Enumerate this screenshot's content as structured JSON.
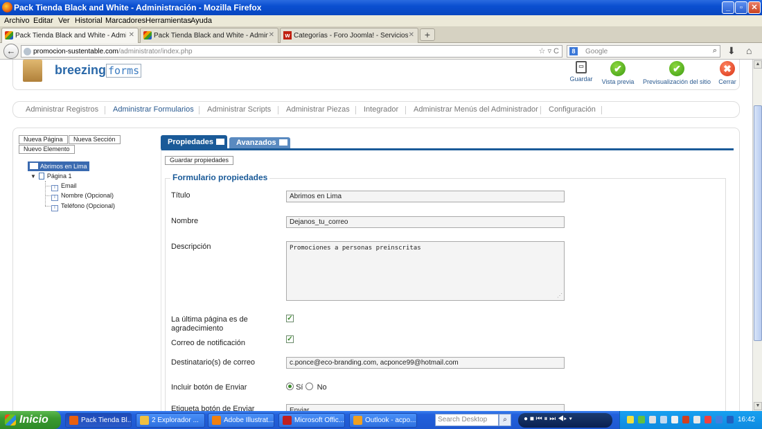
{
  "window": {
    "title": "Pack Tienda Black and White - Administración - Mozilla Firefox",
    "minimize": "_",
    "maximize": "▫",
    "close": "✕"
  },
  "menubar": [
    "Archivo",
    "Editar",
    "Ver",
    "Historial",
    "Marcadores",
    "Herramientas",
    "Ayuda"
  ],
  "tabs": [
    {
      "label": "Pack Tienda Black and White - Administra...",
      "close": "✕",
      "icon": "joomla-icon"
    },
    {
      "label": "Pack Tienda Black and White - Administra...",
      "close": "✕",
      "icon": "joomla-icon"
    },
    {
      "label": "Categorías - Foro Joomla! - Servicios We...",
      "close": "✕",
      "icon": "forum-icon"
    }
  ],
  "newtab": "+",
  "nav": {
    "back": "←",
    "url_host": "promocion-sustentable.com",
    "url_path": "/administrator/index.php",
    "url_tools": "☆ ▿ C",
    "search_placeholder": "Google",
    "search_engine_letter": "8",
    "search_go": "⌕",
    "download": "⬇",
    "home": "⌂"
  },
  "header": {
    "logo_brand": "breezing",
    "logo_forms": "forms",
    "toolbar": [
      {
        "label": "Guardar",
        "glyph": "▭"
      },
      {
        "label": "Vista previa",
        "glyph": "✔"
      },
      {
        "label": "Previsualización del sitio",
        "glyph": "✔"
      },
      {
        "label": "Cerrar",
        "glyph": "✖"
      }
    ]
  },
  "main_menu": [
    "Administrar Registros",
    "Administrar Formularios",
    "Administrar Scripts",
    "Administrar Piezas",
    "Integrador",
    "Administrar Menús del Administrador",
    "Configuración"
  ],
  "left_buttons": [
    "Nueva Página",
    "Nueva Sección",
    "Nuevo Elemento"
  ],
  "tree": {
    "root": "Abrimos en Lima",
    "page": "Página 1",
    "expand": "▼",
    "field_glyph": "I",
    "fields": [
      "Email",
      "Nombre (Opcional)",
      "Teléfono (Opcional)"
    ]
  },
  "panel_tabs": [
    "Propiedades",
    "Avanzados"
  ],
  "save_props": "Guardar propiedades",
  "form": {
    "legend": "Formulario propiedades",
    "titulo_label": "Título",
    "titulo_value": "Abrimos en Lima",
    "nombre_label": "Nombre",
    "nombre_value": "Dejanos_tu_correo",
    "descripcion_label": "Descripción",
    "descripcion_value": "Promociones a personas preinscritas",
    "textarea_grip": "⋰",
    "ultima_label": "La última página es de agradecimiento",
    "ultima_checked": true,
    "correo_label": "Correo de notificación",
    "correo_checked": true,
    "check_glyph": "✓",
    "dest_label": "Destinatario(s) de correo",
    "dest_value": "c.ponce@eco-branding.com, acponce99@hotmail.com",
    "enviar_label": "Incluir botón de Enviar",
    "radio_si": "Sí",
    "radio_no": "No",
    "etiqueta_label": "Etiqueta botón de Enviar",
    "etiqueta_value": "Enviar"
  },
  "scrollbar": {
    "up": "▲",
    "down": "▼"
  },
  "taskbar": {
    "start": "Inicio",
    "items": [
      {
        "label": "Pack Tienda Bl...",
        "color": "#e86010"
      },
      {
        "label": "2 Explorador ...",
        "color": "#f0c040"
      },
      {
        "label": "Adobe Illustrat...",
        "color": "#f08010"
      },
      {
        "label": "Microsoft Offic...",
        "color": "#c02020"
      },
      {
        "label": "Outlook - acpo...",
        "color": "#f0a020"
      }
    ],
    "search_placeholder": "Search Desktop",
    "search_go": "⌕",
    "media_controls": "● ■ ⏮ ⏸ ⏭ ◀▸ ▾",
    "clock": "16:42"
  }
}
